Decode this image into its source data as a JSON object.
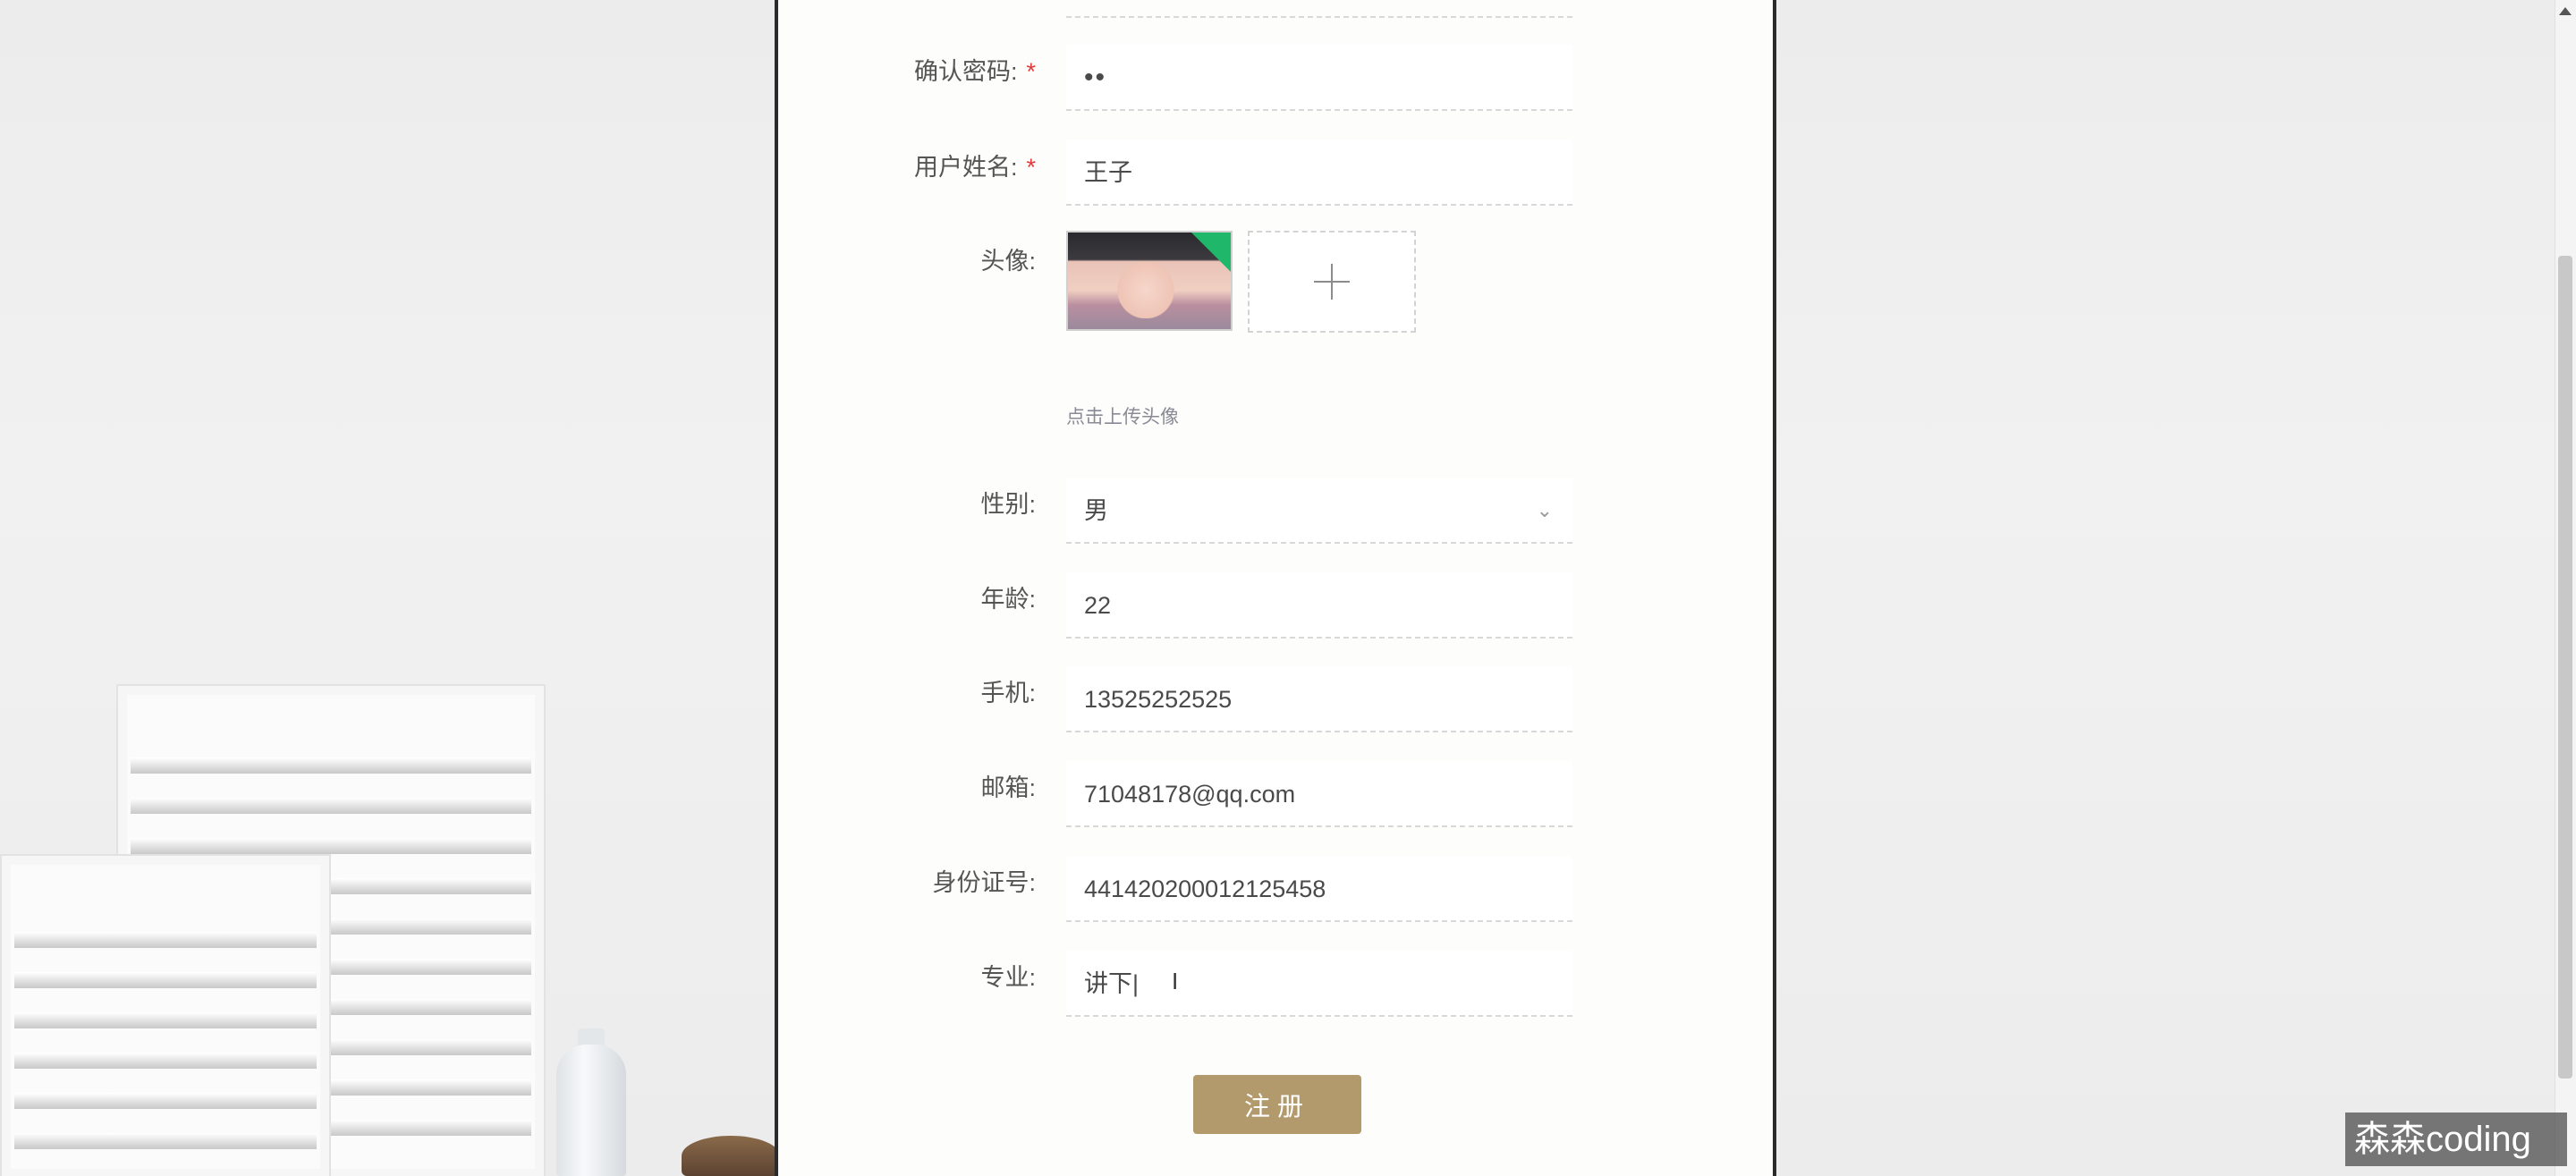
{
  "form": {
    "confirm_password": {
      "label": "确认密码:",
      "required": "*",
      "value": "••"
    },
    "real_name": {
      "label": "用户姓名:",
      "required": "*",
      "value": "王子"
    },
    "avatar": {
      "label": "头像:",
      "hint": "点击上传头像",
      "upload_icon": "plus-icon"
    },
    "gender": {
      "label": "性别:",
      "value": "男",
      "icon": "chevron-down-icon"
    },
    "age": {
      "label": "年龄:",
      "value": "22"
    },
    "phone": {
      "label": "手机:",
      "value": "13525252525"
    },
    "email": {
      "label": "邮箱:",
      "value": "71048178@qq.com"
    },
    "id_number": {
      "label": "身份证号:",
      "value": "441420200012125458"
    },
    "major": {
      "label": "专业:",
      "value": "讲下|"
    },
    "submit_label": "注册"
  },
  "watermark": "森森coding",
  "colors": {
    "button": "#b39a6c",
    "required": "#e23b3b",
    "badge": "#1fb86a"
  }
}
